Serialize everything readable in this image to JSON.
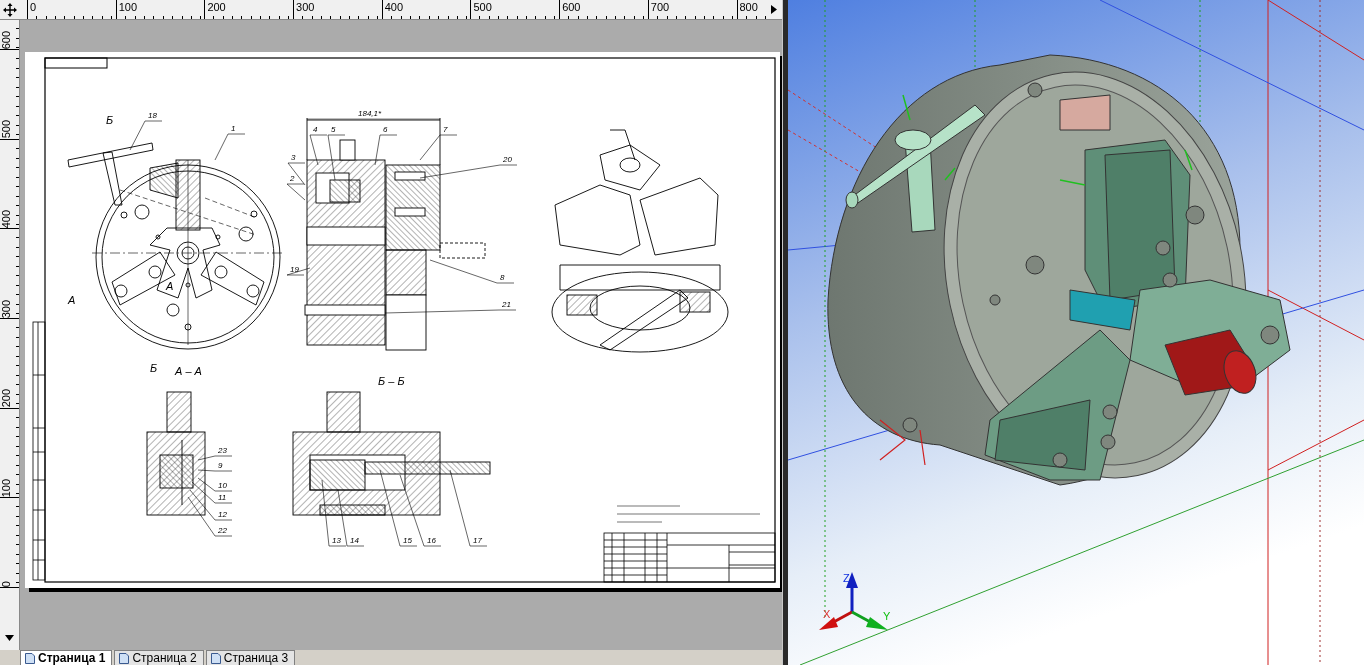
{
  "ruler": {
    "horizontal_ticks": [
      "0",
      "100",
      "200",
      "300",
      "400",
      "500",
      "600",
      "700",
      "800"
    ],
    "vertical_ticks": [
      "600",
      "500",
      "400",
      "300",
      "200",
      "100",
      "0"
    ]
  },
  "sheet": {
    "callouts": [
      "18",
      "1",
      "4",
      "5",
      "6",
      "7",
      "3",
      "20",
      "2",
      "19",
      "8",
      "21",
      "23",
      "9",
      "10",
      "11",
      "12",
      "22",
      "13",
      "14",
      "15",
      "16",
      "17"
    ],
    "dimension": "184,1*",
    "section_marks": [
      "Б",
      "А",
      "А",
      "Б"
    ],
    "view_titles": [
      "А – А",
      "Б – Б"
    ]
  },
  "page_tabs": [
    {
      "label": "Страница 1",
      "selected": true
    },
    {
      "label": "Страница 2",
      "selected": false
    },
    {
      "label": "Страница 3",
      "selected": false
    }
  ],
  "model_view": {
    "axes": [
      "X",
      "Y",
      "Z"
    ]
  }
}
